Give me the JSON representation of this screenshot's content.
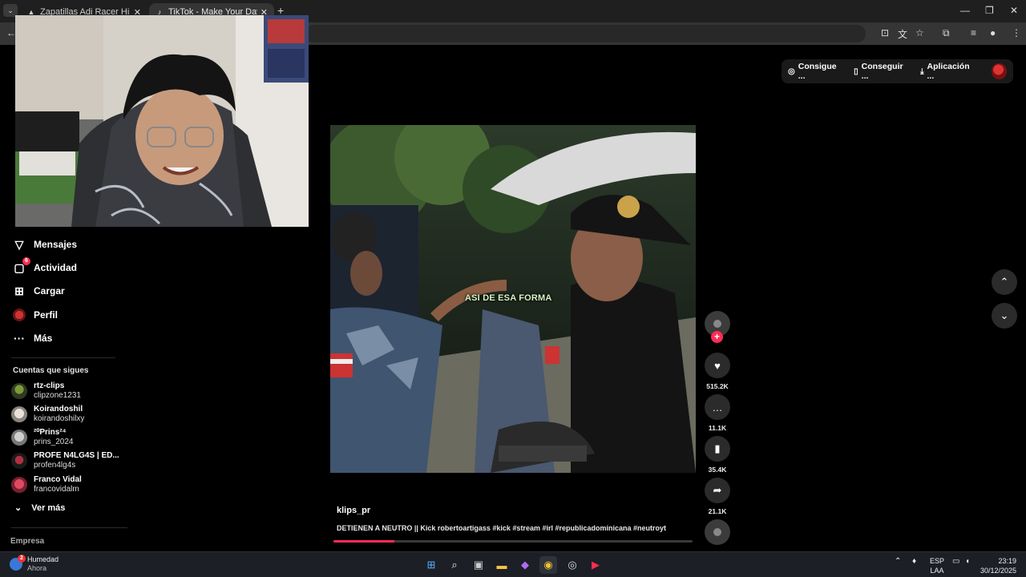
{
  "browser": {
    "tabs": [
      {
        "title": "Zapatillas Adi Racer Hi - Azul a",
        "active": false
      },
      {
        "title": "TikTok - Make Your Day",
        "active": true
      }
    ]
  },
  "header": {
    "buttons": [
      {
        "label": "Consigue ...",
        "icon": "coin-icon"
      },
      {
        "label": "Conseguir ...",
        "icon": "phone-icon"
      },
      {
        "label": "Aplicación ...",
        "icon": "download-icon"
      }
    ]
  },
  "sidebar": {
    "nav": [
      {
        "label": "Mensajes",
        "icon": "send-icon"
      },
      {
        "label": "Actividad",
        "icon": "inbox-icon",
        "badge": "6"
      },
      {
        "label": "Cargar",
        "icon": "upload-icon"
      },
      {
        "label": "Perfil",
        "icon": "profile-icon"
      },
      {
        "label": "Más",
        "icon": "more-icon"
      }
    ],
    "following_title": "Cuentas que sigues",
    "following": [
      {
        "name": "rtz-clips",
        "username": "clipzone1231"
      },
      {
        "name": "Koirandoshil",
        "username": "koirandoshilxy"
      },
      {
        "name": "²⁰Prins²⁴",
        "username": "prins_2024"
      },
      {
        "name": "PROFE N4LG4S | ED...",
        "username": "profen4lg4s"
      },
      {
        "name": "Franco Vidal",
        "username": "francovidalm"
      }
    ],
    "see_more": "Ver más",
    "company": "Empresa"
  },
  "video": {
    "overlay_text": "ASI DE ESA FORMA",
    "author": "klips_pr",
    "description": "DETIENEN A NEUTRO || Kick robertoartigass #kick #stream #irl #republicadominicana #neutroyt",
    "progress": 0.17
  },
  "actions": {
    "likes": "515.2K",
    "comments": "11.1K",
    "saves": "35.4K",
    "shares": "21.1K"
  },
  "taskbar": {
    "weather_label": "Humedad",
    "weather_sub": "Ahora",
    "weather_badge": "2",
    "lang_top": "ESP",
    "lang_bottom": "LAA",
    "time": "23:19",
    "date": "30/12/2025"
  },
  "colors": {
    "accent": "#fe2c55",
    "background": "#000000",
    "button_bg": "#2b2b2b"
  }
}
